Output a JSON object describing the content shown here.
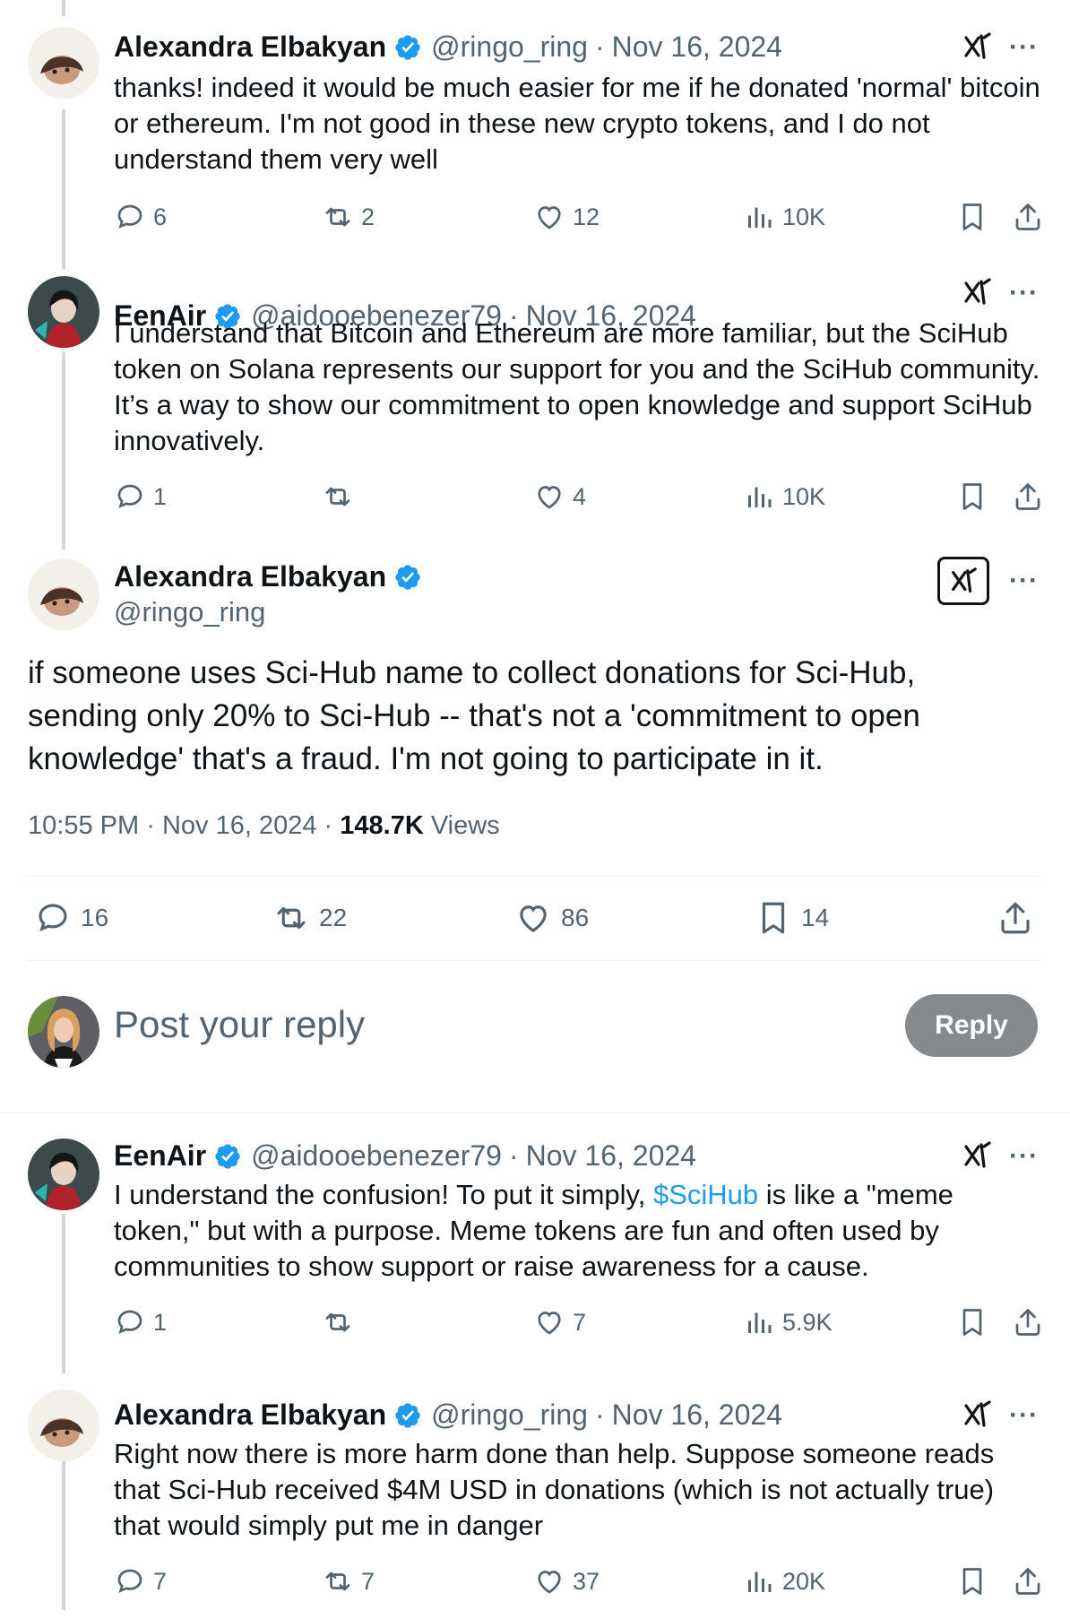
{
  "tweets": [
    {
      "name": "Alexandra Elbakyan",
      "handle": "@ringo_ring",
      "date": "Nov 16, 2024",
      "text": "thanks! indeed it would be much easier for me if he donated 'normal' bitcoin or ethereum. I'm not good in these new crypto tokens, and I do not understand them very well",
      "replies": "6",
      "retweets": "2",
      "likes": "12",
      "views": "10K"
    },
    {
      "name": "EenAir",
      "handle": "@aidooebenezer79",
      "date": "Nov 16, 2024",
      "text": "I understand that Bitcoin and Ethereum are more familiar, but the SciHub token on Solana represents our support for you and the SciHub community. It’s a way to show our commitment to open knowledge and support SciHub innovatively.",
      "replies": "1",
      "retweets": "",
      "likes": "4",
      "views": "10K"
    }
  ],
  "main_tweet": {
    "name": "Alexandra Elbakyan",
    "handle": "@ringo_ring",
    "text": "if someone uses Sci-Hub name to collect donations for Sci-Hub, sending only 20% to Sci-Hub -- that's not a 'commitment to open knowledge' that's a fraud. I'm not going to participate in it.",
    "time": "10:55 PM",
    "date": "Nov 16, 2024",
    "views_count": "148.7K",
    "views_label": "Views",
    "replies": "16",
    "retweets": "22",
    "likes": "86",
    "bookmarks": "14"
  },
  "reply_composer": {
    "placeholder": "Post your reply",
    "button_label": "Reply"
  },
  "replies_below": [
    {
      "name": "EenAir",
      "handle": "@aidooebenezer79",
      "date": "Nov 16, 2024",
      "text_before": "I understand the confusion! To put it simply, ",
      "cashtag": "$SciHub",
      "text_after": " is like a \"meme token,\" but with a purpose. Meme tokens are fun and often used by communities to show support or raise awareness for a cause.",
      "replies": "1",
      "retweets": "",
      "likes": "7",
      "views": "5.9K"
    },
    {
      "name": "Alexandra Elbakyan",
      "handle": "@ringo_ring",
      "date": "Nov 16, 2024",
      "text": "Right now there is more harm done than help. Suppose someone reads that Sci-Hub received $4M USD in donations (which is not actually true) that would simply put me in danger",
      "replies": "7",
      "retweets": "7",
      "likes": "37",
      "views": "20K"
    }
  ],
  "separator": "·",
  "more_symbol": "···",
  "colors": {
    "verified": "#1d9bf0",
    "link": "#1d9bf0",
    "muted": "#536471",
    "reply_button": "#878a8c"
  }
}
